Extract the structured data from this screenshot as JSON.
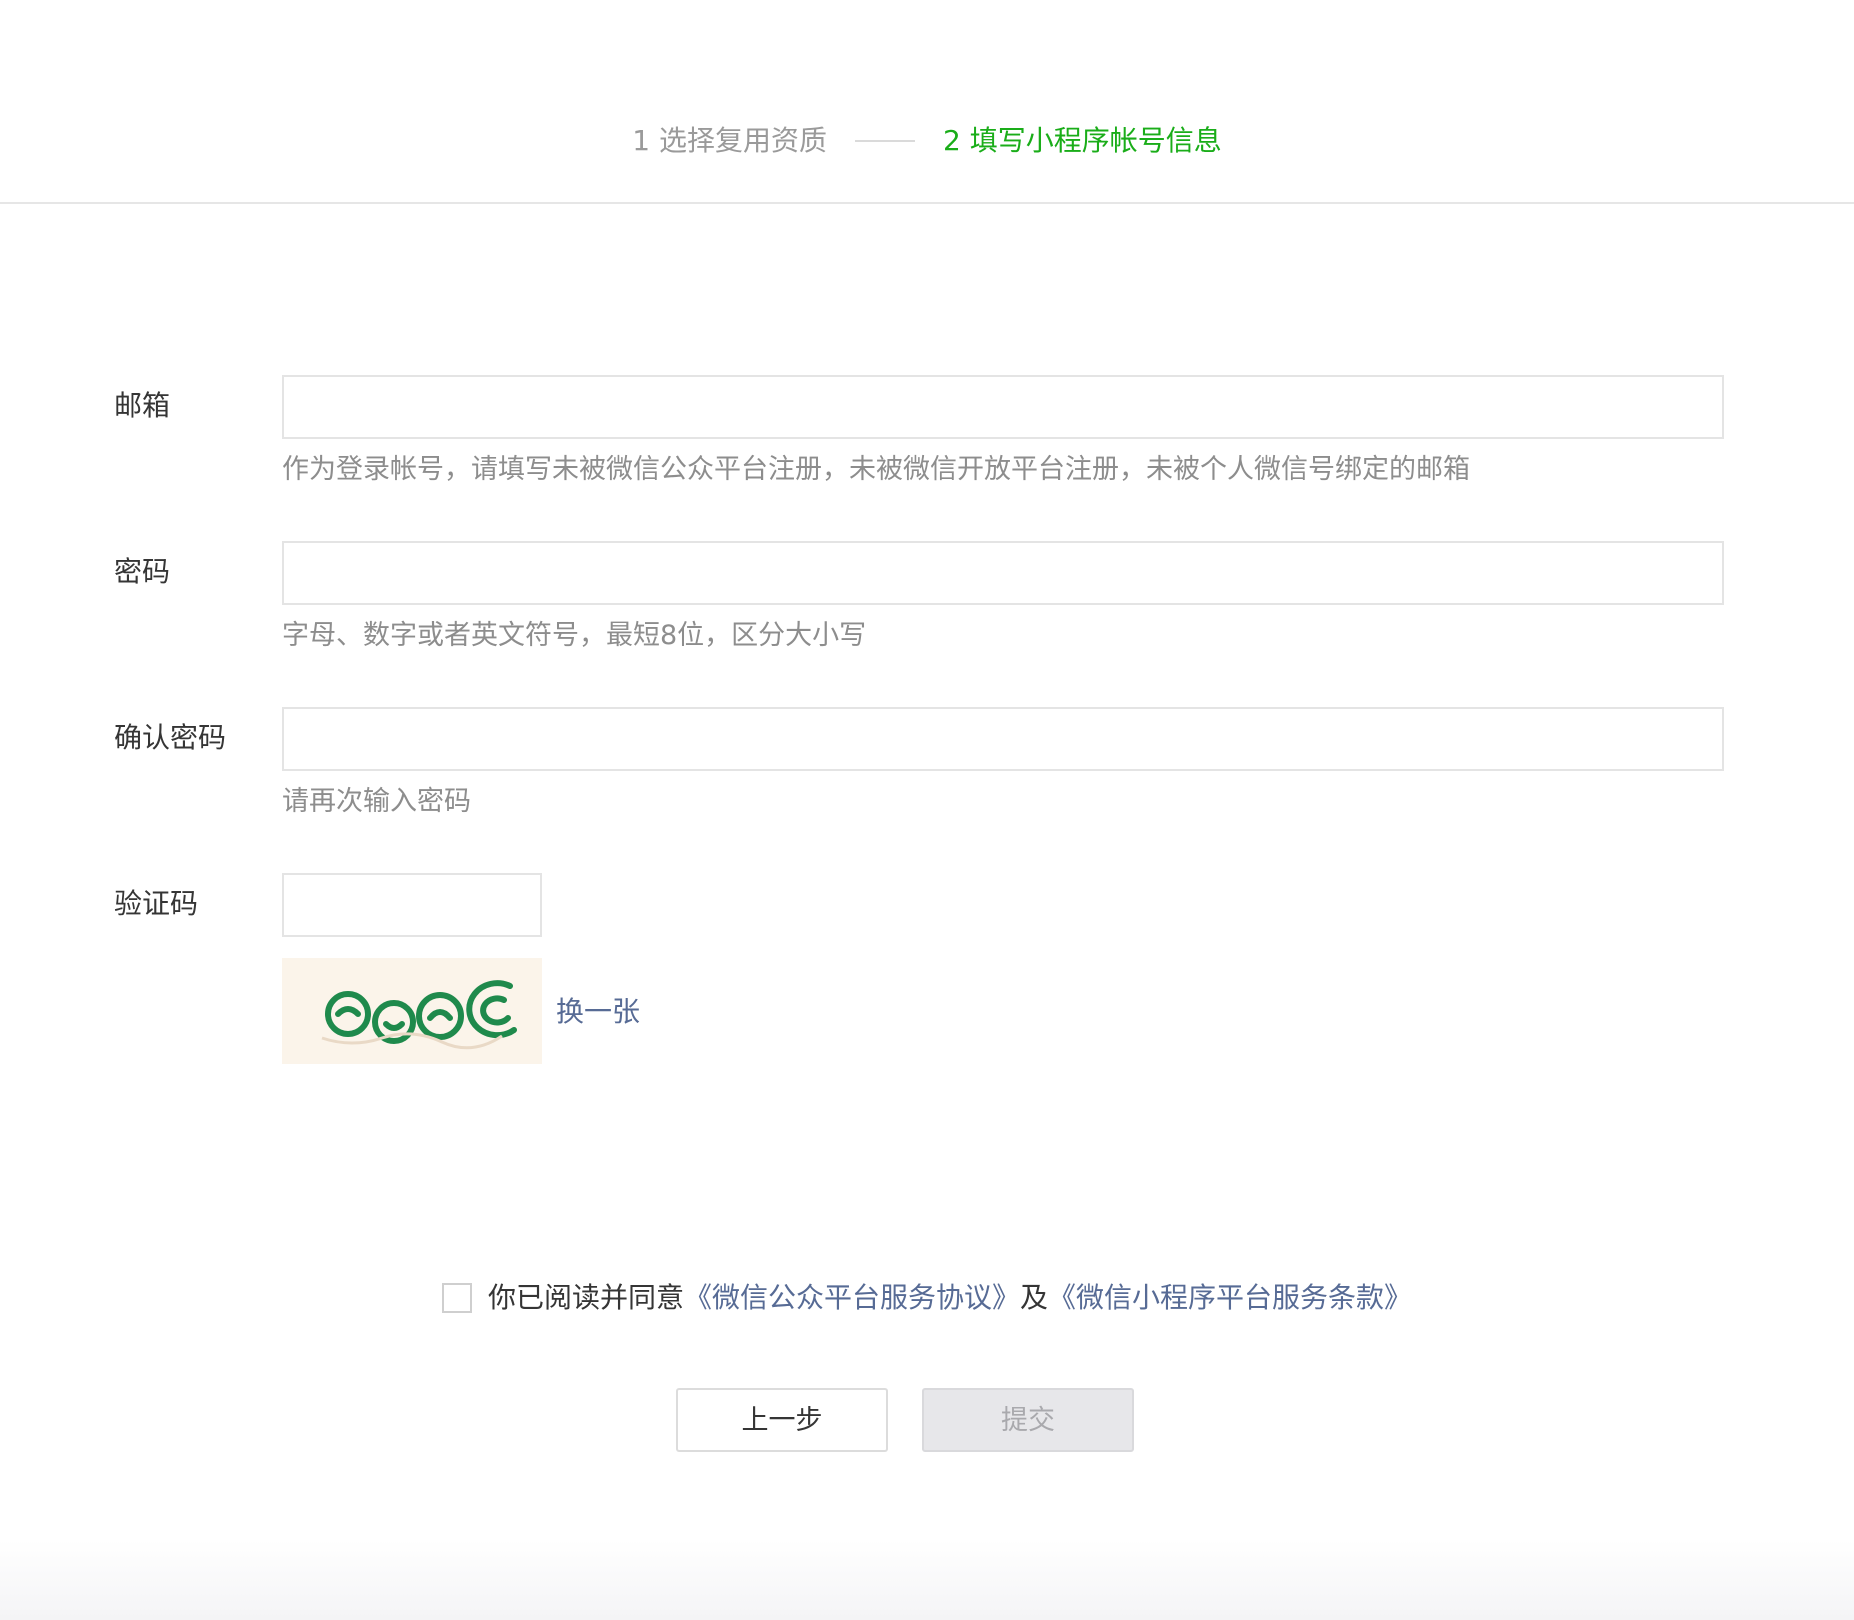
{
  "steps": [
    {
      "label": "1 选择复用资质",
      "state": "done"
    },
    {
      "label": "2 填写小程序帐号信息",
      "state": "active"
    }
  ],
  "form": {
    "email": {
      "label": "邮箱",
      "value": "",
      "tip": "作为登录帐号，请填写未被微信公众平台注册，未被微信开放平台注册，未被个人微信号绑定的邮箱"
    },
    "password": {
      "label": "密码",
      "value": "",
      "tip": "字母、数字或者英文符号，最短8位，区分大小写"
    },
    "confirm_password": {
      "label": "确认密码",
      "value": "",
      "tip": "请再次输入密码"
    },
    "captcha": {
      "label": "验证码",
      "value": "",
      "refresh_label": "换一张"
    }
  },
  "agreement": {
    "checked": false,
    "prefix": "你已阅读并同意",
    "link1": "《微信公众平台服务协议》",
    "middle": "及",
    "link2": "《微信小程序平台服务条款》"
  },
  "buttons": {
    "prev_label": "上一步",
    "submit_label": "提交",
    "submit_disabled": true
  },
  "colors": {
    "active_step": "#1aad19",
    "link": "#576b95",
    "tip": "#8d8d8d"
  }
}
